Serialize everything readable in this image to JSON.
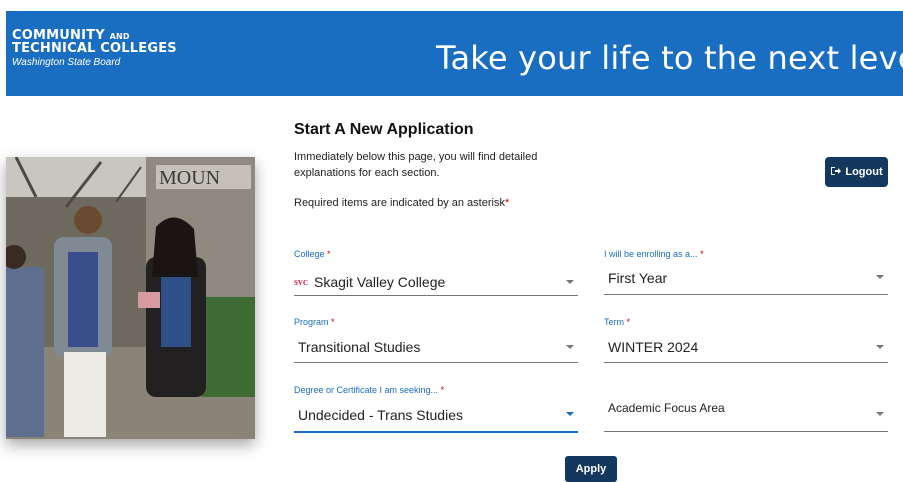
{
  "header": {
    "logo_line1": "COMMUNITY",
    "logo_line1_small": "AND",
    "logo_line2": "TECHNICAL COLLEGES",
    "logo_line3": "Washington State Board",
    "tagline": "Take your life to the next level!"
  },
  "photo": {
    "sign_text": "MOUN"
  },
  "form": {
    "title": "Start A New Application",
    "intro": "Immediately below this page, you will find detailed explanations for each section.",
    "required_note": "Required items are indicated by an asterisk",
    "asterisk": "*",
    "logout_label": "Logout",
    "apply_label": "Apply",
    "fields": {
      "college": {
        "label": "College",
        "required": "*",
        "badge": "SVC",
        "value": "Skagit Valley College"
      },
      "enrolling": {
        "label": "I will be enrolling as a...",
        "required": "*",
        "value": "First Year"
      },
      "program": {
        "label": "Program",
        "required": "*",
        "value": "Transitional Studies"
      },
      "term": {
        "label": "Term",
        "required": "*",
        "value": "WINTER 2024"
      },
      "degree": {
        "label": "Degree or Certificate I am seeking...",
        "required": "*",
        "value": "Undecided - Trans Studies"
      },
      "focus": {
        "label": "",
        "placeholder": "Academic Focus Area",
        "value": ""
      }
    }
  },
  "colors": {
    "banner": "#1a6ec1",
    "button": "#14375f",
    "required": "#d00000",
    "accent": "#1a6ec1"
  },
  "icons": {
    "logout": "logout-arrow-icon",
    "dropdown": "caret-down-icon"
  }
}
